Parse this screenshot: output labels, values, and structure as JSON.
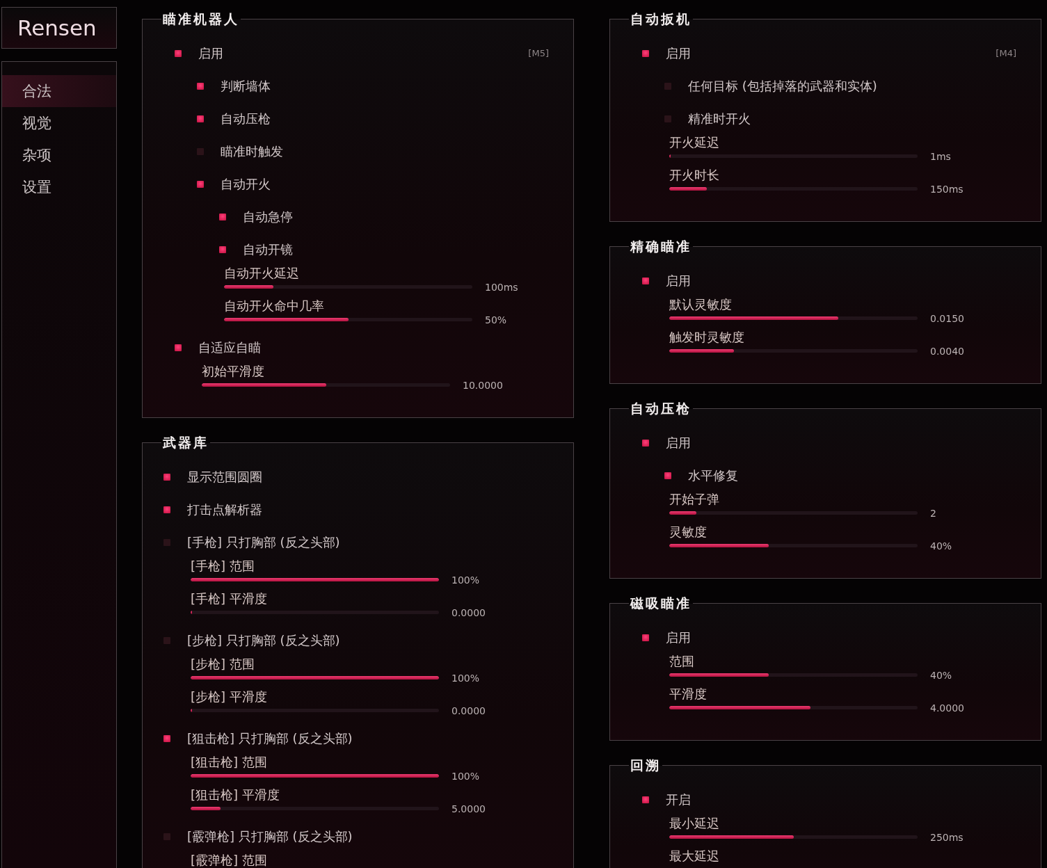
{
  "logo": "Rensen",
  "nav": [
    {
      "label": "合法",
      "selected": true
    },
    {
      "label": "视觉",
      "selected": false
    },
    {
      "label": "杂项",
      "selected": false
    },
    {
      "label": "设置",
      "selected": false
    }
  ],
  "columns": [
    {
      "panels": [
        {
          "title": "瞄准机器人",
          "items": [
            {
              "kind": "checkbox",
              "label": "启用",
              "checked": true,
              "hotkey": "[M5]",
              "children": [
                {
                  "kind": "checkbox",
                  "label": "判断墙体",
                  "checked": true
                },
                {
                  "kind": "checkbox",
                  "label": "自动压枪",
                  "checked": true
                },
                {
                  "kind": "checkbox",
                  "label": "瞄准时触发",
                  "checked": false
                },
                {
                  "kind": "checkbox",
                  "label": "自动开火",
                  "checked": true,
                  "children": [
                    {
                      "kind": "checkbox",
                      "label": "自动急停",
                      "checked": true
                    },
                    {
                      "kind": "checkbox",
                      "label": "自动开镜",
                      "checked": true
                    },
                    {
                      "kind": "slider",
                      "label": "自动开火延迟",
                      "level": 0.2,
                      "value": "100ms"
                    },
                    {
                      "kind": "slider",
                      "label": "自动开火命中几率",
                      "level": 0.5,
                      "value": "50%"
                    }
                  ]
                }
              ]
            },
            {
              "kind": "checkbox",
              "label": "自适应自瞄",
              "checked": true,
              "children": [
                {
                  "kind": "slider",
                  "label": "初始平滑度",
                  "level": 0.5,
                  "value": "10.0000"
                }
              ]
            }
          ]
        },
        {
          "title": "武器库",
          "items": [
            {
              "kind": "checkbox",
              "label": "显示范围圆圈",
              "checked": true
            },
            {
              "kind": "checkbox",
              "label": "打击点解析器",
              "checked": true
            },
            {
              "kind": "checkbox",
              "label": "[手枪] 只打胸部 (反之头部)",
              "checked": false,
              "children": [
                {
                  "kind": "slider",
                  "label": "[手枪] 范围",
                  "level": 1,
                  "value": "100%"
                },
                {
                  "kind": "slider",
                  "label": "[手枪] 平滑度",
                  "level": 0,
                  "value": "0.0000"
                }
              ]
            },
            {
              "kind": "checkbox",
              "label": "[步枪] 只打胸部 (反之头部)",
              "checked": false,
              "children": [
                {
                  "kind": "slider",
                  "label": "[步枪] 范围",
                  "level": 1,
                  "value": "100%"
                },
                {
                  "kind": "slider",
                  "label": "[步枪] 平滑度",
                  "level": 0,
                  "value": "0.0000"
                }
              ]
            },
            {
              "kind": "checkbox",
              "label": "[狙击枪] 只打胸部 (反之头部)",
              "checked": true,
              "children": [
                {
                  "kind": "slider",
                  "label": "[狙击枪] 范围",
                  "level": 1,
                  "value": "100%"
                },
                {
                  "kind": "slider",
                  "label": "[狙击枪] 平滑度",
                  "level": 0.12,
                  "value": "5.0000"
                }
              ]
            },
            {
              "kind": "checkbox",
              "label": "[霰弹枪] 只打胸部 (反之头部)",
              "checked": false,
              "children": [
                {
                  "kind": "slider",
                  "label": "[霰弹枪] 范围"
                }
              ]
            }
          ]
        }
      ]
    },
    {
      "panels": [
        {
          "title": "自动扳机",
          "items": [
            {
              "kind": "checkbox",
              "label": "启用",
              "checked": true,
              "hotkey": "[M4]",
              "children": [
                {
                  "kind": "checkbox",
                  "label": "任何目标 (包括掉落的武器和实体)",
                  "checked": false
                },
                {
                  "kind": "checkbox",
                  "label": "精准时开火",
                  "checked": false
                },
                {
                  "kind": "slider",
                  "label": "开火延迟",
                  "level": 0,
                  "value": "1ms"
                },
                {
                  "kind": "slider",
                  "label": "开火时长",
                  "level": 0.15,
                  "value": "150ms"
                }
              ]
            }
          ]
        },
        {
          "title": "精确瞄准",
          "items": [
            {
              "kind": "checkbox",
              "label": "启用",
              "checked": true,
              "children": [
                {
                  "kind": "slider",
                  "label": "默认灵敏度",
                  "level": 0.68,
                  "value": "0.0150"
                },
                {
                  "kind": "slider",
                  "label": "触发时灵敏度",
                  "level": 0.26,
                  "value": "0.0040"
                }
              ]
            }
          ]
        },
        {
          "title": "自动压枪",
          "items": [
            {
              "kind": "checkbox",
              "label": "启用",
              "checked": true,
              "children": [
                {
                  "kind": "checkbox",
                  "label": "水平修复",
                  "checked": true
                },
                {
                  "kind": "slider",
                  "label": "开始子弹",
                  "level": 0.11,
                  "value": "2"
                },
                {
                  "kind": "slider",
                  "label": "灵敏度",
                  "level": 0.4,
                  "value": "40%"
                }
              ]
            }
          ]
        },
        {
          "title": "磁吸瞄准",
          "items": [
            {
              "kind": "checkbox",
              "label": "启用",
              "checked": true,
              "children": [
                {
                  "kind": "slider",
                  "label": "范围",
                  "level": 0.4,
                  "value": "40%"
                },
                {
                  "kind": "slider",
                  "label": "平滑度",
                  "level": 0.57,
                  "value": "4.0000"
                }
              ]
            }
          ]
        },
        {
          "title": "回溯",
          "items": [
            {
              "kind": "checkbox",
              "label": "开启",
              "checked": true,
              "children": [
                {
                  "kind": "slider",
                  "label": "最小延迟",
                  "level": 0.5,
                  "value": "250ms"
                },
                {
                  "kind": "slider",
                  "label": "最大延迟"
                }
              ]
            }
          ]
        }
      ]
    }
  ]
}
